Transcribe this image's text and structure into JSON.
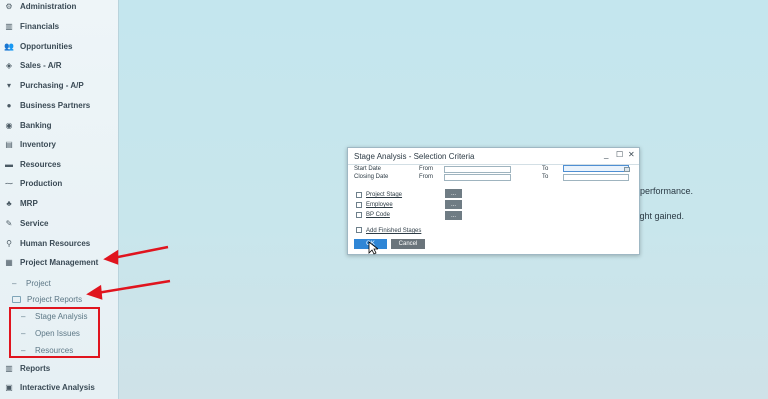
{
  "sidebar": {
    "items": [
      {
        "label": "Administration",
        "icon": "gear-icon"
      },
      {
        "label": "Financials",
        "icon": "chart-icon"
      },
      {
        "label": "Opportunities",
        "icon": "people-icon"
      },
      {
        "label": "Sales - A/R",
        "icon": "tag-icon"
      },
      {
        "label": "Purchasing - A/P",
        "icon": "cart-icon"
      },
      {
        "label": "Business Partners",
        "icon": "person-icon"
      },
      {
        "label": "Banking",
        "icon": "coin-icon"
      },
      {
        "label": "Inventory",
        "icon": "box-icon"
      },
      {
        "label": "Resources",
        "icon": "resources-icon"
      },
      {
        "label": "Production",
        "icon": "production-icon"
      },
      {
        "label": "MRP",
        "icon": "mrp-icon"
      },
      {
        "label": "Service",
        "icon": "service-icon"
      },
      {
        "label": "Human Resources",
        "icon": "hr-icon"
      },
      {
        "label": "Project Management",
        "icon": "project-icon"
      }
    ],
    "project_children": {
      "project": "Project",
      "project_reports": "Project Reports",
      "reports": [
        "Stage Analysis",
        "Open Issues",
        "Resources"
      ]
    },
    "bottom_items": [
      {
        "label": "Reports",
        "icon": "reports-icon"
      },
      {
        "label": "Interactive Analysis",
        "icon": "analysis-icon"
      }
    ]
  },
  "background": {
    "line1": "y performance.",
    "line2": "sight gained."
  },
  "dialog": {
    "title": "Stage Analysis - Selection Criteria",
    "controls": {
      "minimize": "_",
      "maximize": "☐",
      "close": "✕"
    },
    "start_date_label": "Start Date",
    "closing_date_label": "Closing Date",
    "from_label": "From",
    "to_label": "To",
    "checkboxes": {
      "project_stage": "Project Stage",
      "employee": "Employee",
      "bp_code": "BP Code",
      "add_finished": "Add Finished Stages"
    },
    "ellipsis": "...",
    "ok": "OK",
    "cancel": "Cancel"
  },
  "colors": {
    "accent": "#2f86d6",
    "annotation_red": "#e0141e",
    "background": "#c7e7ee"
  }
}
